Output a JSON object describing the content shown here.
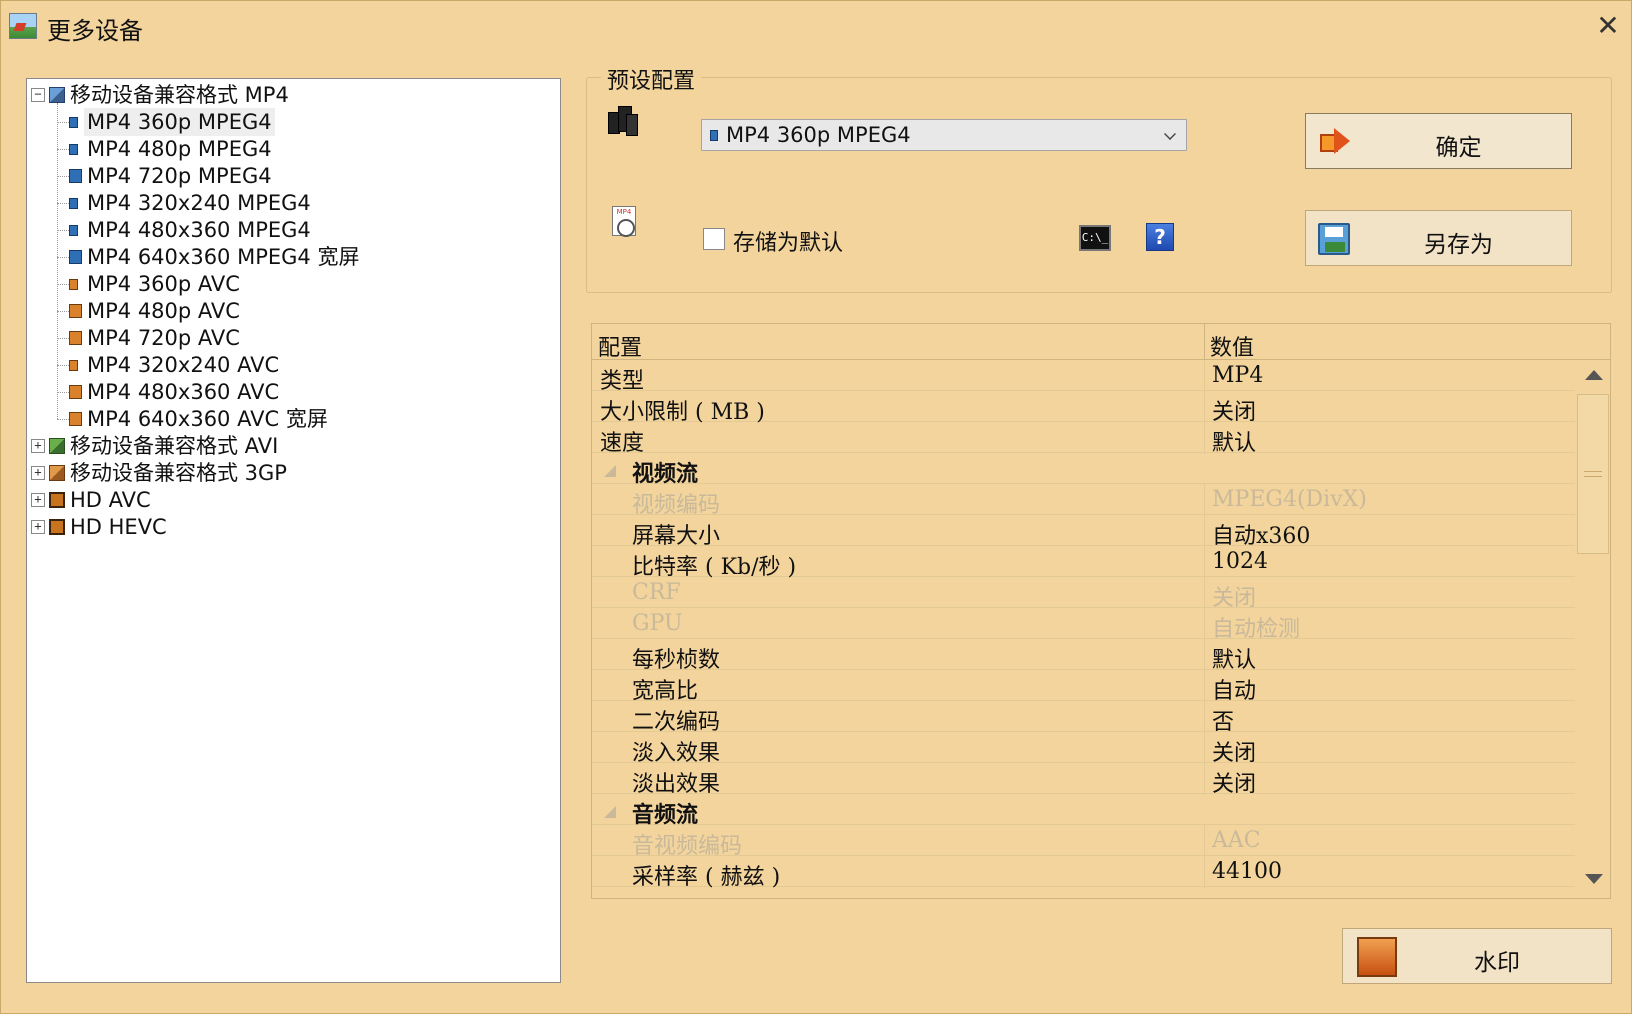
{
  "window": {
    "title": "更多设备"
  },
  "tree": {
    "groups": [
      {
        "label": "移动设备兼容格式 MP4",
        "expanded": true,
        "items": [
          {
            "label": "MP4 360p MPEG4",
            "selected": true
          },
          {
            "label": "MP4 480p MPEG4"
          },
          {
            "label": "MP4 720p MPEG4"
          },
          {
            "label": "MP4 320x240 MPEG4"
          },
          {
            "label": "MP4 480x360 MPEG4"
          },
          {
            "label": "MP4 640x360 MPEG4 宽屏"
          },
          {
            "label": "MP4 360p AVC"
          },
          {
            "label": "MP4 480p AVC"
          },
          {
            "label": "MP4 720p AVC"
          },
          {
            "label": "MP4 320x240 AVC"
          },
          {
            "label": "MP4 480x360 AVC"
          },
          {
            "label": "MP4 640x360 AVC 宽屏"
          }
        ]
      },
      {
        "label": "移动设备兼容格式 AVI",
        "expanded": false
      },
      {
        "label": "移动设备兼容格式 3GP",
        "expanded": false
      },
      {
        "label": "HD AVC",
        "expanded": false
      },
      {
        "label": "HD HEVC",
        "expanded": false
      }
    ]
  },
  "preset": {
    "group_title": "预设配置",
    "dropdown_value": "MP4 360p MPEG4",
    "save_default_label": "存储为默认",
    "save_default_checked": false,
    "cmd_icon_text": "C:\\_",
    "help_icon_text": "?",
    "mp4_icon_text": "MP4",
    "ok_label": "确定",
    "save_as_label": "另存为"
  },
  "grid": {
    "header_key": "配置",
    "header_value": "数值",
    "rows": [
      {
        "key": "类型",
        "value": "MP4",
        "level": 0
      },
      {
        "key": "大小限制 ( MB )",
        "value": "关闭",
        "level": 0
      },
      {
        "key": "速度",
        "value": "默认",
        "level": 0
      },
      {
        "key": "视频流",
        "value": "",
        "level": 0,
        "section": true
      },
      {
        "key": "视频编码",
        "value": "MPEG4(DivX)",
        "level": 1,
        "disabled": true
      },
      {
        "key": "屏幕大小",
        "value": "自动x360",
        "level": 1
      },
      {
        "key": "比特率 ( Kb/秒 )",
        "value": "1024",
        "level": 1
      },
      {
        "key": "CRF",
        "value": "关闭",
        "level": 1,
        "disabled": true
      },
      {
        "key": "GPU",
        "value": "自动检测",
        "level": 1,
        "disabled": true
      },
      {
        "key": "每秒桢数",
        "value": "默认",
        "level": 1
      },
      {
        "key": "宽高比",
        "value": "自动",
        "level": 1
      },
      {
        "key": "二次编码",
        "value": "否",
        "level": 1
      },
      {
        "key": "淡入效果",
        "value": "关闭",
        "level": 1
      },
      {
        "key": "淡出效果",
        "value": "关闭",
        "level": 1
      },
      {
        "key": "音频流",
        "value": "",
        "level": 0,
        "section": true
      },
      {
        "key": "音视频编码",
        "value": "AAC",
        "level": 1,
        "disabled": true
      },
      {
        "key": "采样率 ( 赫兹 )",
        "value": "44100",
        "level": 1
      }
    ]
  },
  "footer": {
    "watermark_label": "水印"
  },
  "icons": {
    "app": "app-picture-icon",
    "close": "close-icon",
    "phone": "mobile-devices-icon",
    "mp4file": "mp4-file-icon",
    "cmd": "command-prompt-icon",
    "help": "help-icon",
    "ok": "arrow-right-icon",
    "save_as": "floppy-disk-icon",
    "watermark": "watermark-icon"
  },
  "colors": {
    "background": "#f2d49c",
    "disabled_text": "#c9b99a",
    "selection": "#eeeeee"
  }
}
